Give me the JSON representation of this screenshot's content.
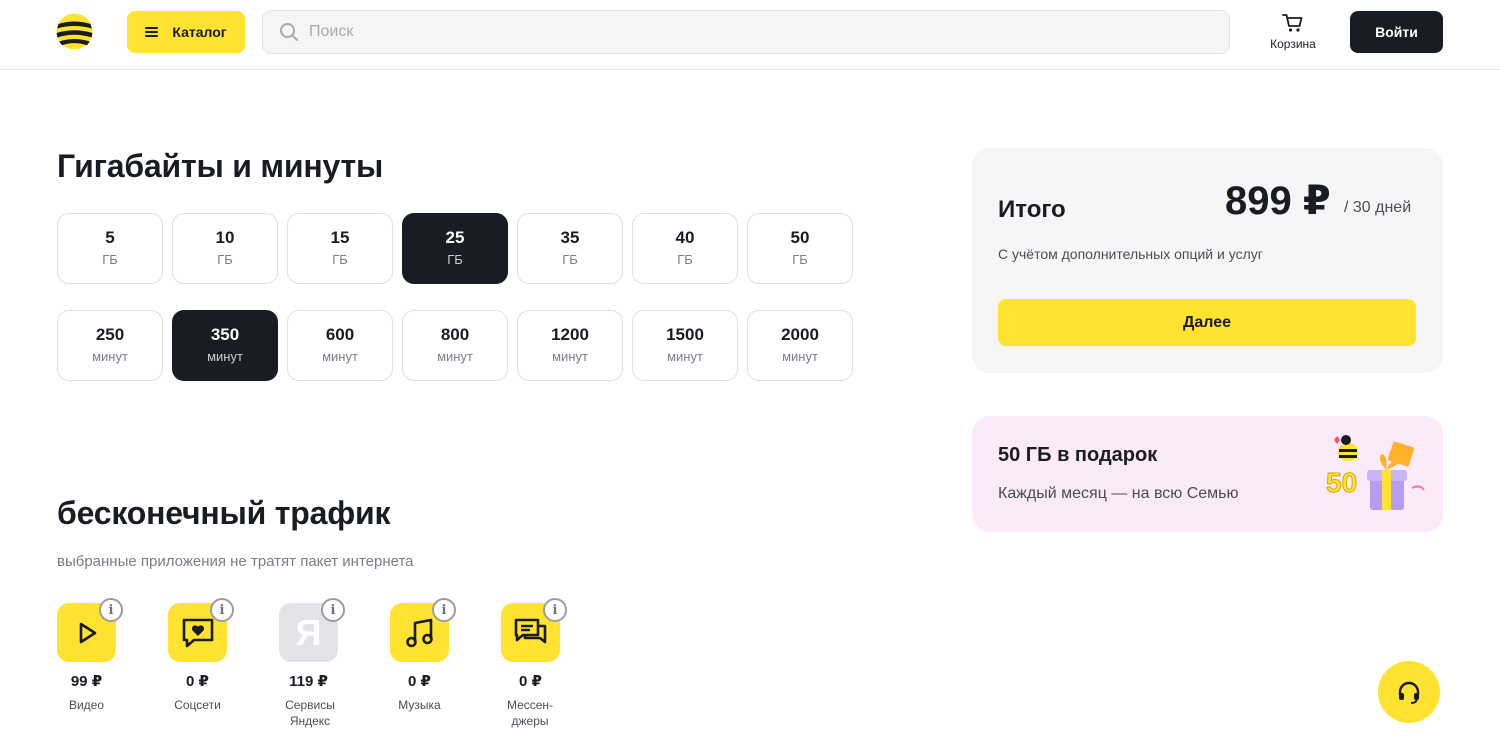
{
  "header": {
    "catalog_label": "Каталог",
    "search_placeholder": "Поиск",
    "cart_label": "Корзина",
    "login_label": "Войти"
  },
  "gb_section": {
    "title": "Гигабайты и минуты",
    "gb_options": [
      {
        "value": "5",
        "unit": "ГБ",
        "selected": false
      },
      {
        "value": "10",
        "unit": "ГБ",
        "selected": false
      },
      {
        "value": "15",
        "unit": "ГБ",
        "selected": false
      },
      {
        "value": "25",
        "unit": "ГБ",
        "selected": true
      },
      {
        "value": "35",
        "unit": "ГБ",
        "selected": false
      },
      {
        "value": "40",
        "unit": "ГБ",
        "selected": false
      },
      {
        "value": "50",
        "unit": "ГБ",
        "selected": false
      }
    ],
    "minute_options": [
      {
        "value": "250",
        "unit": "минут",
        "selected": false
      },
      {
        "value": "350",
        "unit": "минут",
        "selected": true
      },
      {
        "value": "600",
        "unit": "минут",
        "selected": false
      },
      {
        "value": "800",
        "unit": "минут",
        "selected": false
      },
      {
        "value": "1200",
        "unit": "минут",
        "selected": false
      },
      {
        "value": "1500",
        "unit": "минут",
        "selected": false
      },
      {
        "value": "2000",
        "unit": "минут",
        "selected": false
      }
    ]
  },
  "traffic_section": {
    "title": "бесконечный трафик",
    "subtitle": "выбранные приложения не тратят пакет интернета",
    "apps": [
      {
        "icon": "play-icon",
        "price": "99 ₽",
        "label": "Видео"
      },
      {
        "icon": "chat-heart-icon",
        "price": "0 ₽",
        "label": "Соцсети"
      },
      {
        "icon": "yandex-icon",
        "price": "119 ₽",
        "label": "Сервисы Яндекс"
      },
      {
        "icon": "music-note-icon",
        "price": "0 ₽",
        "label": "Музыка"
      },
      {
        "icon": "messenger-icon",
        "price": "0 ₽",
        "label": "Мессен-джеры"
      }
    ],
    "info_glyph": "i",
    "yandex_letter": "Я"
  },
  "summary": {
    "title": "Итого",
    "price": "899 ₽",
    "period": "/ 30 дней",
    "note": "С учётом дополнительных опций и услуг",
    "next_label": "Далее"
  },
  "gift_banner": {
    "title": "50 ГБ в подарок",
    "text": "Каждый месяц — на всю Семью",
    "art_text": "50"
  },
  "colors": {
    "accent": "#ffe330",
    "dark": "#191c22",
    "panel": "#f6f6f7",
    "gift_bg": "#fbeaf9"
  }
}
